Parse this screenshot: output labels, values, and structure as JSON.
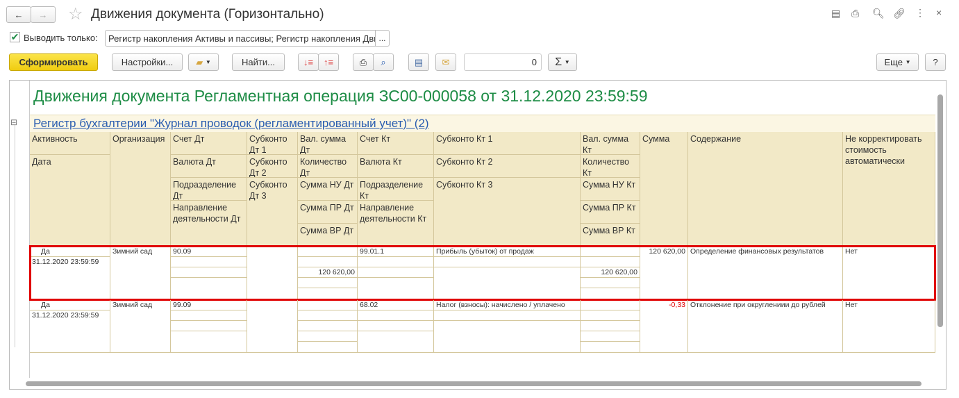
{
  "window": {
    "title": "Движения документа (Горизонтально)",
    "back": "←",
    "forward": "→",
    "star": "☆",
    "close": "×",
    "more": "⋮"
  },
  "filter": {
    "label": "Выводить только:",
    "value": "Регистр накопления Активы и пассивы; Регистр накопления Дви",
    "select": "...",
    "checked": true
  },
  "toolbar": {
    "generate": "Сформировать",
    "settings": "Настройки...",
    "find": "Найти...",
    "number_value": "0",
    "sum": "Σ",
    "more": "Еще",
    "help": "?"
  },
  "report": {
    "title": "Движения документа Регламентная операция ЗС00-000058 от 31.12.2020 23:59:59",
    "section": "Регистр бухгалтерии \"Журнал проводок (регламентированный учет)\" (2)",
    "collapse": "⊟",
    "headers": [
      "Активность",
      "Дата",
      "Организация",
      "Счет Дт",
      "Валюта Дт",
      "Подразделение Дт",
      "Направление деятельности Дт",
      "Субконто Дт 1",
      "Субконто Дт 2",
      "Субконто Дт 3",
      "Вал. сумма Дт",
      "Количество Дт",
      "Сумма НУ Дт",
      "Сумма ПР Дт",
      "Сумма ВР Дт",
      "Счет Кт",
      "Валюта Кт",
      "Подразделение Кт",
      "Направление деятельности Кт",
      "Субконто Кт 1",
      "Субконто Кт 2",
      "Субконто Кт 3",
      "Вал. сумма Кт",
      "Количество Кт",
      "Сумма НУ Кт",
      "Сумма ПР Кт",
      "Сумма ВР Кт",
      "Сумма",
      "Содержание",
      "Не корректировать стоимость автоматически"
    ],
    "rows": [
      {
        "active": "Да",
        "date": "31.12.2020 23:59:59",
        "org": "Зимний сад",
        "acc_dt": "90.09",
        "sum_nu_dt": "120 620,00",
        "acc_kt": "99.01.1",
        "subkonto_kt1": "Прибыль (убыток) от продаж",
        "sum_nu_kt": "120 620,00",
        "sum": "120 620,00",
        "content": "Определение финансовых результатов",
        "no_adjust": "Нет",
        "highlighted": true
      },
      {
        "active": "Да",
        "date": "31.12.2020 23:59:59",
        "org": "Зимний сад",
        "acc_dt": "99.09",
        "sum_nu_dt": "",
        "acc_kt": "68.02",
        "subkonto_kt1": "Налог (взносы): начислено / уплачено",
        "sum_nu_kt": "",
        "sum": "-0,33",
        "content": "Отклонение при округлениии до рублей",
        "no_adjust": "Нет",
        "highlighted": false
      }
    ]
  },
  "colors": {
    "title_green": "#1d8c45",
    "link_blue": "#2a5db0",
    "header_bg": "#f2e9c7",
    "highlight": "#e00000",
    "negative": "#e00000",
    "primary_button": "#f5d313"
  }
}
